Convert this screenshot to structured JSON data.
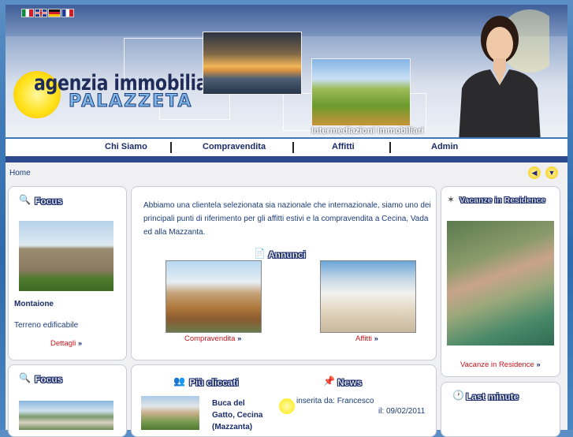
{
  "header": {
    "flags": [
      "Italiano",
      "English",
      "Deutsch",
      "Français"
    ],
    "logo_line1": "agenzia immobiliare",
    "logo_line2": "PALAZZETA",
    "tagline": "Intermediazioni Immobiliari"
  },
  "nav": {
    "items": [
      "Chi Siamo",
      "Compravendita",
      "Affitti",
      "Admin"
    ]
  },
  "breadcrumb": "Home",
  "focus1": {
    "title": "Focus",
    "name": "Montaione",
    "desc": "Terreno edificabile",
    "link": "Dettagli",
    "link_arrow": "»"
  },
  "intro": {
    "text": "Abbiamo una clientela selezionata sia nazionale che internazionale, siamo uno dei principali punti di riferimento per gli affitti estivi e la compravendita a Cecina, Vada ed alla Mazzanta."
  },
  "annunci": {
    "title": "Annunci",
    "items": [
      {
        "label": "Compravendita",
        "arrow": "»"
      },
      {
        "label": "Affitti",
        "arrow": "»"
      }
    ]
  },
  "residence": {
    "title": "Vacanze in Residence",
    "link": "Vacanze in Residence",
    "arrow": "»"
  },
  "focus2": {
    "title": "Focus"
  },
  "piu_cliccati": {
    "title": "Più cliccati",
    "item_line1": "Buca del",
    "item_line2": "Gatto, Cecina",
    "item_line3": "(Mazzanta)"
  },
  "news": {
    "title": "News",
    "author": "inserita da: Francesco",
    "date": "il: 09/02/2011"
  },
  "last_minute": {
    "title": "Last minute"
  },
  "colors": {
    "nav_text": "#1b2c6b",
    "link_red": "#c4141a",
    "accent_yellow": "#ffe21a"
  }
}
